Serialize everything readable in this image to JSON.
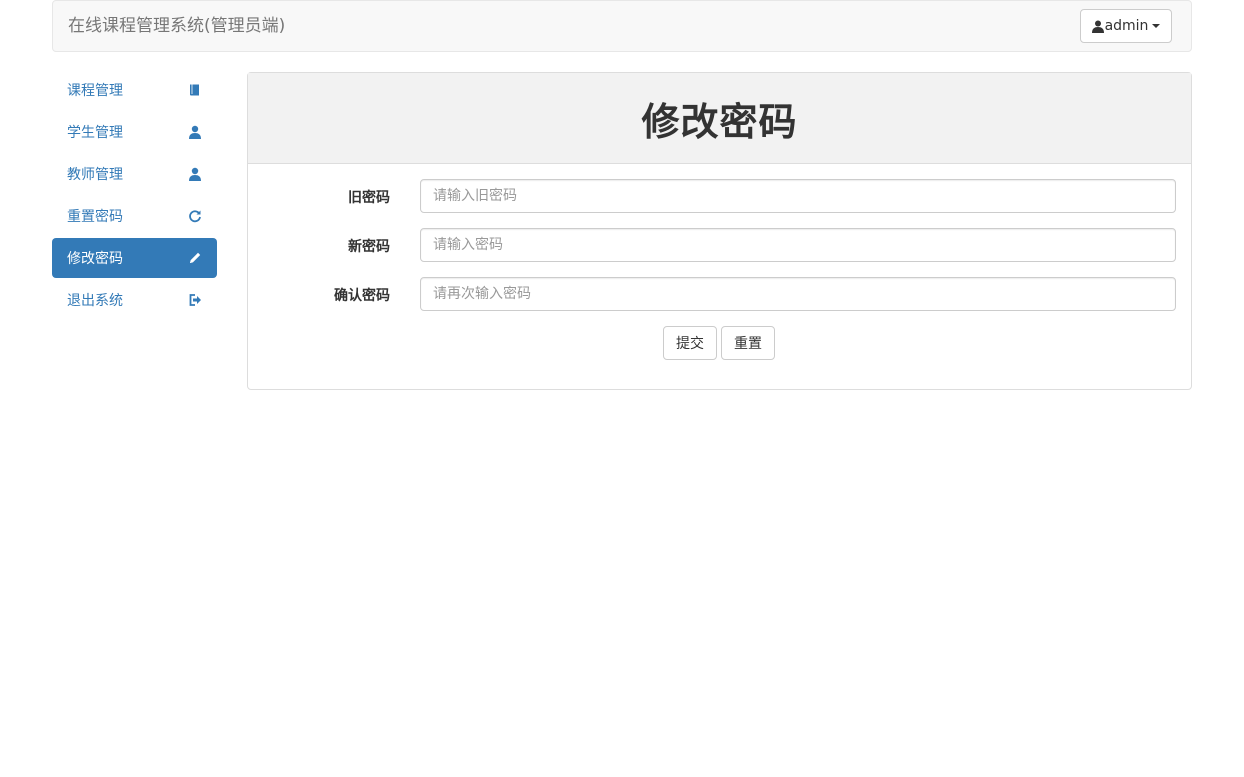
{
  "header": {
    "title": "在线课程管理系统(管理员端)",
    "user_label": "admin"
  },
  "sidebar": {
    "items": [
      {
        "label": "课程管理",
        "icon": "book-icon",
        "active": false
      },
      {
        "label": "学生管理",
        "icon": "user-icon",
        "active": false
      },
      {
        "label": "教师管理",
        "icon": "user-icon",
        "active": false
      },
      {
        "label": "重置密码",
        "icon": "refresh-icon",
        "active": false
      },
      {
        "label": "修改密码",
        "icon": "pencil-icon",
        "active": true
      },
      {
        "label": "退出系统",
        "icon": "logout-icon",
        "active": false
      }
    ]
  },
  "main": {
    "title": "修改密码",
    "fields": [
      {
        "label": "旧密码",
        "placeholder": "请输入旧密码",
        "value": ""
      },
      {
        "label": "新密码",
        "placeholder": "请输入密码",
        "value": ""
      },
      {
        "label": "确认密码",
        "placeholder": "请再次输入密码",
        "value": ""
      }
    ],
    "submit_label": "提交",
    "reset_label": "重置"
  },
  "colors": {
    "accent": "#337ab7",
    "navbar_bg": "#f8f8f8",
    "panel_heading_bg": "#f2f2f2"
  }
}
